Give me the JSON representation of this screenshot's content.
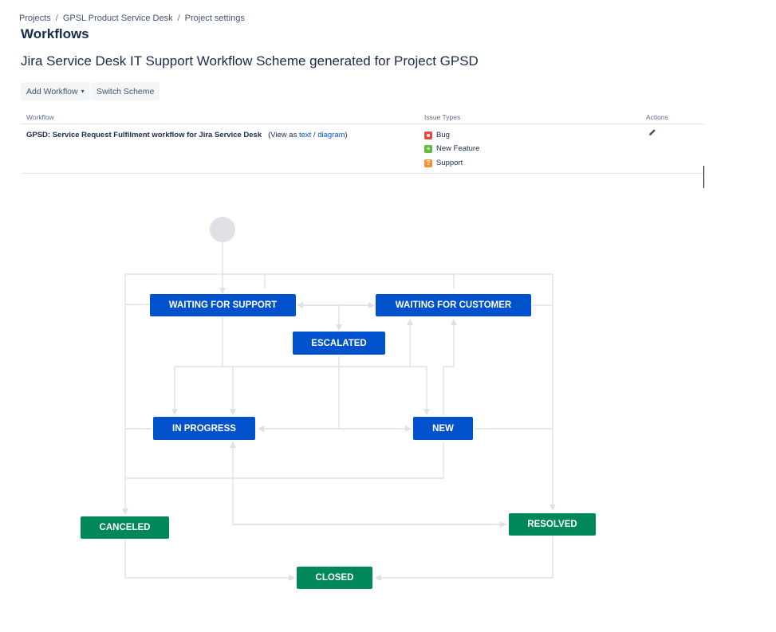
{
  "breadcrumb": {
    "items": [
      "Projects",
      "GPSL Product Service Desk",
      "Project settings"
    ],
    "separator": "/"
  },
  "page_title": "Workflows",
  "scheme_title": "Jira Service Desk IT Support Workflow Scheme generated for Project GPSD",
  "toolbar": {
    "add_workflow_label": "Add Workflow",
    "switch_scheme_label": "Switch Scheme"
  },
  "table": {
    "headers": {
      "workflow": "Workflow",
      "issue_types": "Issue Types",
      "actions": "Actions"
    },
    "row": {
      "workflow_name": "GPSD: Service Request Fulfilment workflow for Jira Service Desk",
      "view_as_prefix": "(View as",
      "view_text_link": "text",
      "view_slash": "/",
      "view_diagram_link": "diagram",
      "view_suffix": ")",
      "issue_types": [
        {
          "name": "Bug",
          "icon": "bug-icon",
          "color": "#e5493a"
        },
        {
          "name": "New Feature",
          "icon": "new-feature-icon",
          "color": "#63ba3c"
        },
        {
          "name": "Support",
          "icon": "support-icon",
          "color": "#f79232"
        }
      ]
    }
  },
  "diagram": {
    "statuses": {
      "waiting_for_support": "WAITING FOR SUPPORT",
      "waiting_for_customer": "WAITING FOR CUSTOMER",
      "escalated": "ESCALATED",
      "in_progress": "IN PROGRESS",
      "new": "NEW",
      "canceled": "CANCELED",
      "resolved": "RESOLVED",
      "closed": "CLOSED"
    },
    "colors": {
      "in_progress_category": "#0052cc",
      "done_category": "#00875a",
      "transition_line": "#dfe1e6",
      "start_node": "#dfe1e6"
    }
  }
}
